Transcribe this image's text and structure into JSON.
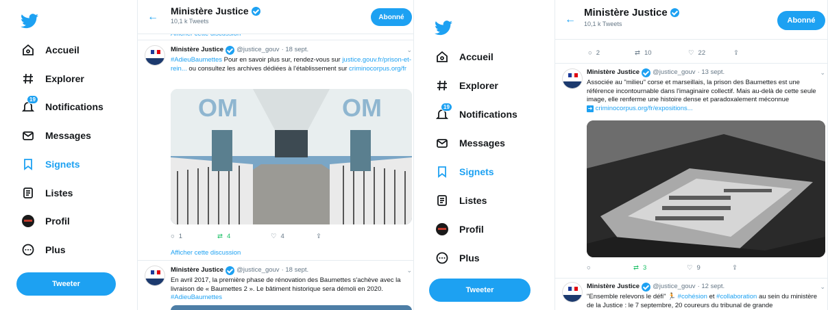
{
  "colors": {
    "accent": "#1da1f2",
    "retweet_green": "#17bf63",
    "text": "#14171a",
    "muted": "#657786"
  },
  "nav": {
    "items": [
      {
        "label": "Accueil",
        "icon": "home-icon"
      },
      {
        "label": "Explorer",
        "icon": "hash-icon"
      },
      {
        "label": "Notifications",
        "icon": "bell-icon",
        "badge": "19"
      },
      {
        "label": "Messages",
        "icon": "mail-icon"
      },
      {
        "label": "Signets",
        "icon": "bookmark-icon"
      },
      {
        "label": "Listes",
        "icon": "list-icon"
      },
      {
        "label": "Profil",
        "icon": "profile-avatar-icon"
      },
      {
        "label": "Plus",
        "icon": "more-icon"
      }
    ],
    "tweet_button": "Tweeter"
  },
  "header": {
    "back": "←",
    "name": "Ministère Justice",
    "count": "10,1 k Tweets",
    "follow": "Abonné"
  },
  "left": {
    "top_show_thread": "Afficher cette discussion",
    "tweet1": {
      "name": "Ministère Justice",
      "handle": "@justice_gouv",
      "date": "· 18 sept.",
      "hashtag": "#AdieuBaumettes",
      "text": " Pour en savoir plus sur, rendez-vous sur ",
      "link1": "justice.gouv.fr/prison-et-rein...",
      "text2": " ou consultez les archives dédiées à l'établissement sur ",
      "link2": "criminocorpus.org/fr",
      "replies": "1",
      "retweets": "4",
      "likes": "4",
      "show_thread": "Afficher cette discussion"
    },
    "tweet2": {
      "name": "Ministère Justice",
      "handle": "@justice_gouv",
      "date": "· 18 sept.",
      "text": "En avril 2017, la première phase de rénovation des Baumettes s'achève avec la livraison de « Baumettes 2 ». Le bâtiment historique sera démoli en 2020.",
      "hashtag": "#AdieuBaumettes"
    }
  },
  "right": {
    "top_actions": {
      "replies": "2",
      "retweets": "10",
      "likes": "22"
    },
    "tweet1": {
      "name": "Ministère Justice",
      "handle": "@justice_gouv",
      "date": "· 13 sept.",
      "text": "Associée au \"milieu\" corse et marseillais, la prison des Baumettes est une référence incontournable dans l'imaginaire collectif. Mais au-delà de cette seule image, elle renferme une histoire dense et paradoxalement méconnue",
      "link_icon": "right-arrow-box-icon",
      "link": "criminocorpus.org/fr/expositions...",
      "replies": "",
      "retweets": "3",
      "likes": "9"
    },
    "tweet2": {
      "name": "Ministère Justice",
      "handle": "@justice_gouv",
      "date": "· 12 sept.",
      "text1": "\"Ensemble relevons le défi\" ",
      "emoji": "🏃",
      "hashtag1": "#cohésion",
      "and": " et ",
      "hashtag2": "#collaboration",
      "text2": " au sein du ministère de la Justice : le 7 septembre, 20 coureurs du tribunal de grande"
    }
  }
}
